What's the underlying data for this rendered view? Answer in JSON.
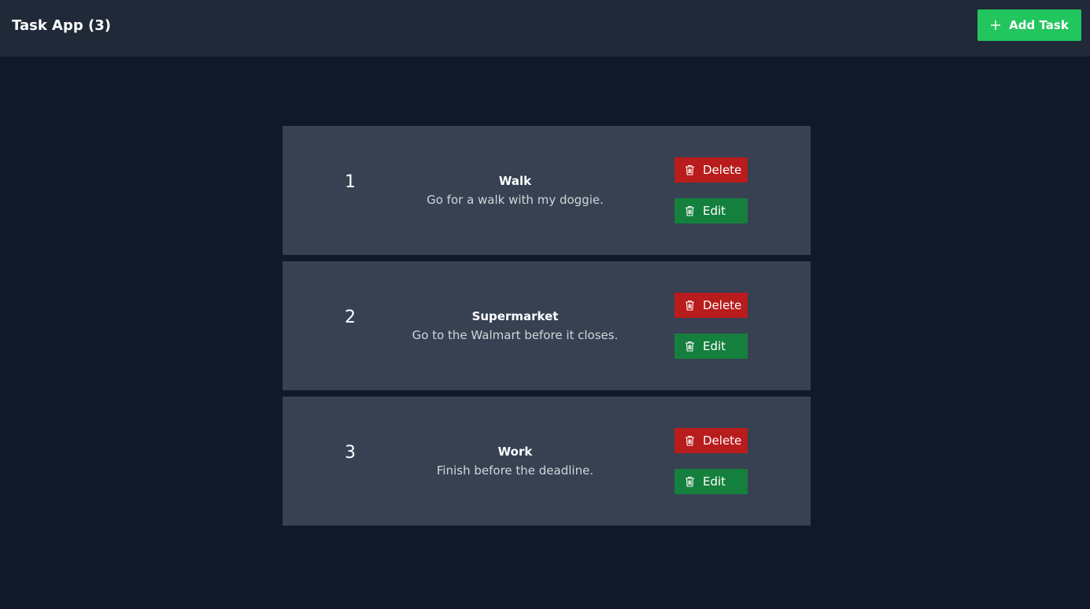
{
  "header": {
    "title": "Task App (3)",
    "add_task_label": "Add Task"
  },
  "tasks": [
    {
      "number": "1",
      "title": "Walk",
      "description": "Go for a walk with my doggie.",
      "delete_label": "Delete",
      "edit_label": "Edit"
    },
    {
      "number": "2",
      "title": "Supermarket",
      "description": "Go to the Walmart before it closes.",
      "delete_label": "Delete",
      "edit_label": "Edit"
    },
    {
      "number": "3",
      "title": "Work",
      "description": "Finish before the deadline.",
      "delete_label": "Delete",
      "edit_label": "Edit"
    }
  ],
  "icons": {
    "add": "plus-icon",
    "delete": "trash-icon",
    "edit": "trash-icon"
  },
  "colors": {
    "background": "#111827",
    "header": "#1f2937",
    "card": "#374151",
    "add_button": "#22c55e",
    "delete_button": "#b91c1c",
    "edit_button": "#15803d"
  }
}
